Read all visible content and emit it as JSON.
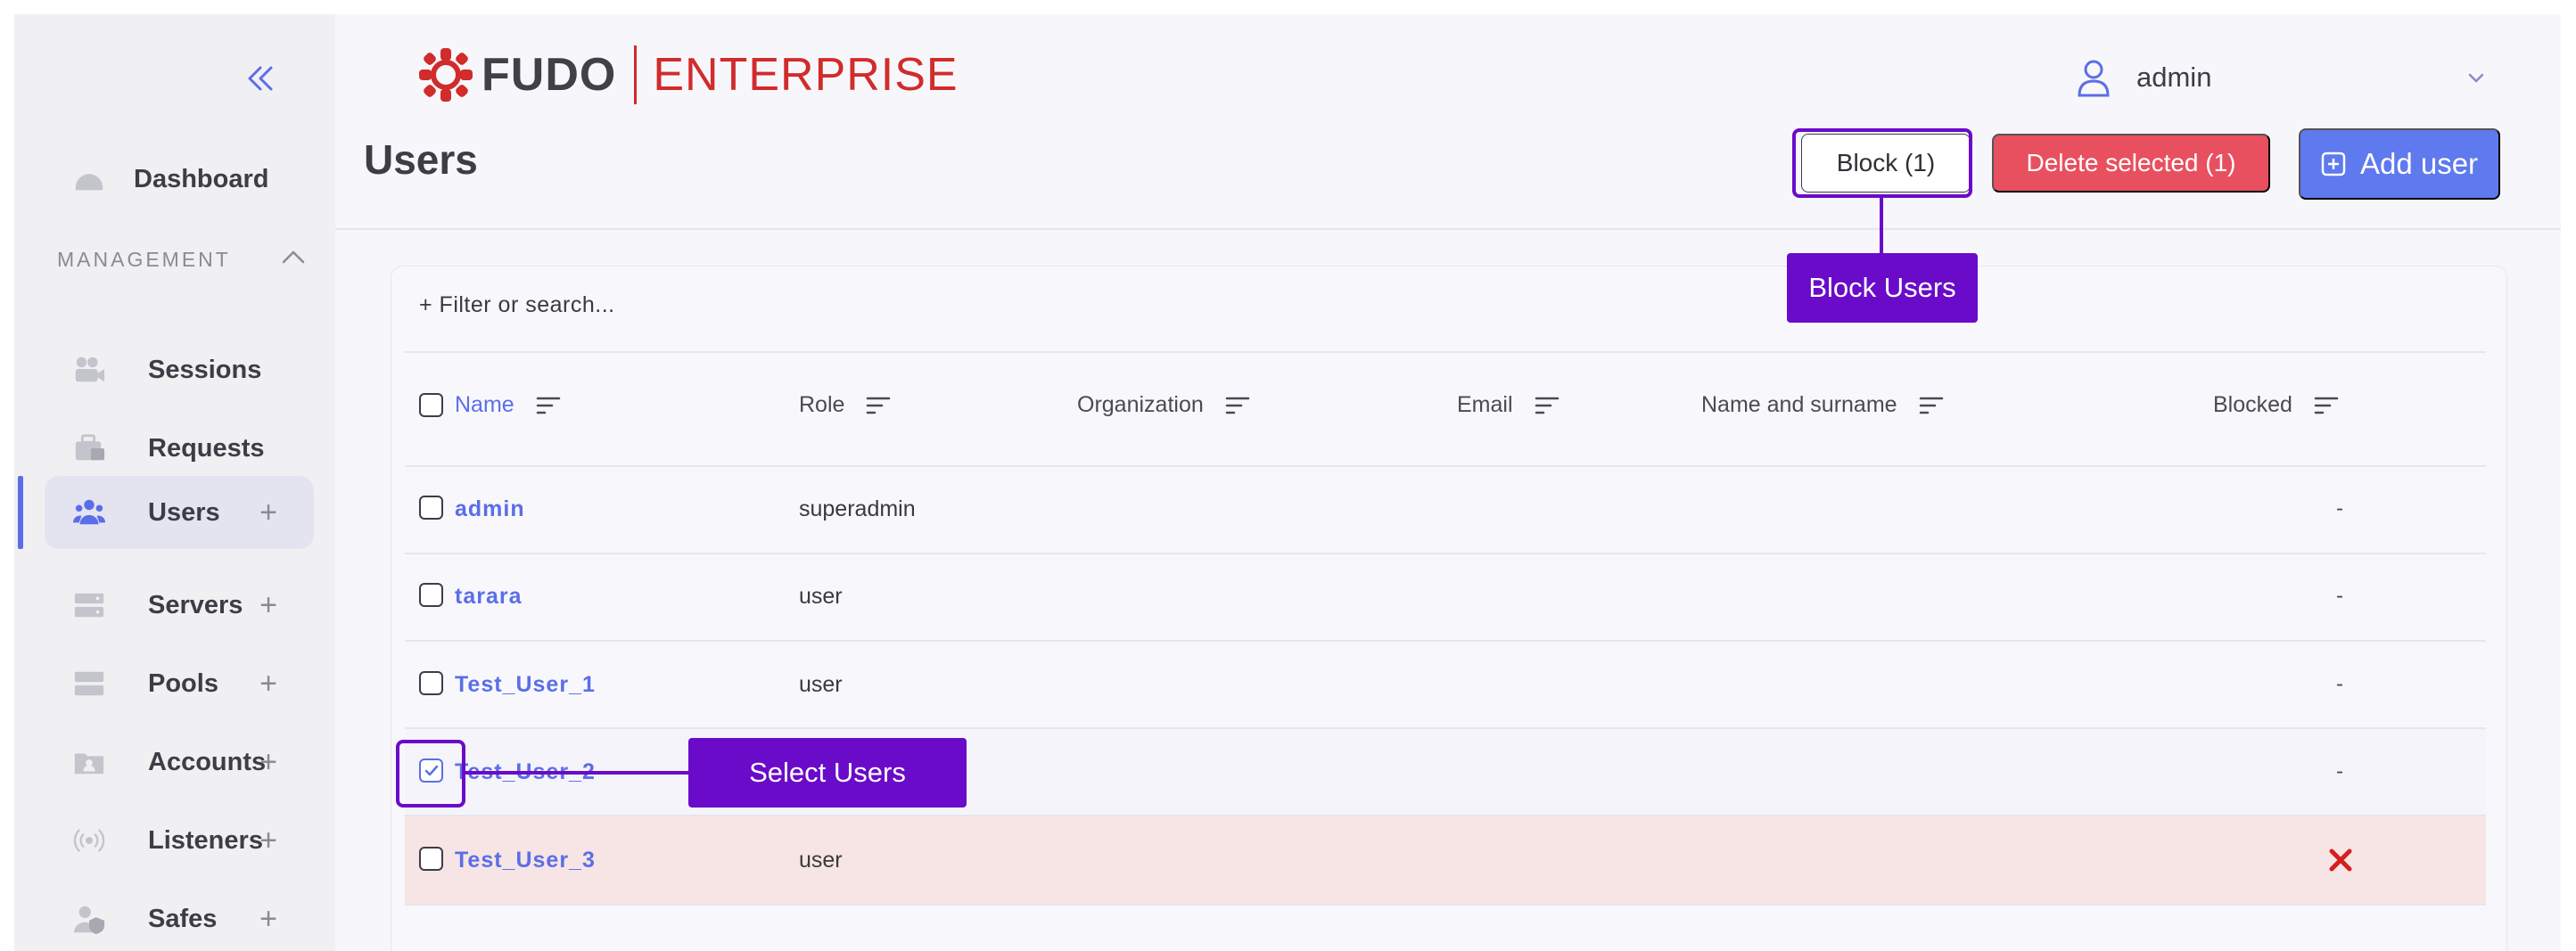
{
  "brand": {
    "name": "FUDO",
    "edition": "ENTERPRISE"
  },
  "user_menu": {
    "username": "admin",
    "user_icon": "user-icon",
    "chevron_icon": "chevron-down-icon"
  },
  "sidebar": {
    "collapse_icon": "double-chevron-left-icon",
    "dashboard": {
      "label": "Dashboard",
      "icon": "dashboard-icon"
    },
    "section": {
      "title": "MANAGEMENT",
      "toggle_icon": "chevron-up-icon"
    },
    "items": [
      {
        "label": "Sessions",
        "icon": "sessions-icon",
        "addable": false,
        "active": false
      },
      {
        "label": "Requests",
        "icon": "requests-icon",
        "addable": false,
        "active": false
      },
      {
        "label": "Users",
        "icon": "users-icon",
        "addable": true,
        "active": true
      },
      {
        "label": "Servers",
        "icon": "servers-icon",
        "addable": true,
        "active": false
      },
      {
        "label": "Pools",
        "icon": "pools-icon",
        "addable": true,
        "active": false
      },
      {
        "label": "Accounts",
        "icon": "accounts-icon",
        "addable": true,
        "active": false
      },
      {
        "label": "Listeners",
        "icon": "listeners-icon",
        "addable": true,
        "active": false
      },
      {
        "label": "Safes",
        "icon": "safes-icon",
        "addable": true,
        "active": false
      }
    ],
    "plus_label": "+"
  },
  "page": {
    "title": "Users"
  },
  "toolbar": {
    "block_label": "Block (1)",
    "delete_label": "Delete selected (1)",
    "add_label": "Add user"
  },
  "table": {
    "filter_placeholder": "+ Filter or search...",
    "columns": [
      "Name",
      "Role",
      "Organization",
      "Email",
      "Name and surname",
      "Blocked"
    ],
    "rows": [
      {
        "name": "admin",
        "role": "superadmin",
        "blocked": "-",
        "checked": false,
        "is_blocked": false
      },
      {
        "name": "tarara",
        "role": "user",
        "blocked": "-",
        "checked": false,
        "is_blocked": false
      },
      {
        "name": "Test_User_1",
        "role": "user",
        "blocked": "-",
        "checked": false,
        "is_blocked": false
      },
      {
        "name": "Test_User_2",
        "role": "",
        "blocked": "-",
        "checked": true,
        "is_blocked": false
      },
      {
        "name": "Test_User_3",
        "role": "user",
        "blocked": "",
        "checked": false,
        "is_blocked": true
      }
    ]
  },
  "annotations": {
    "block_users": "Block Users",
    "select_users": "Select Users"
  },
  "colors": {
    "accent": "#5b6ee8",
    "brand_red": "#d12b2b",
    "danger": "#e8505f",
    "annotation": "#6a0bc9",
    "blocked_row": "#f7e4e4"
  }
}
